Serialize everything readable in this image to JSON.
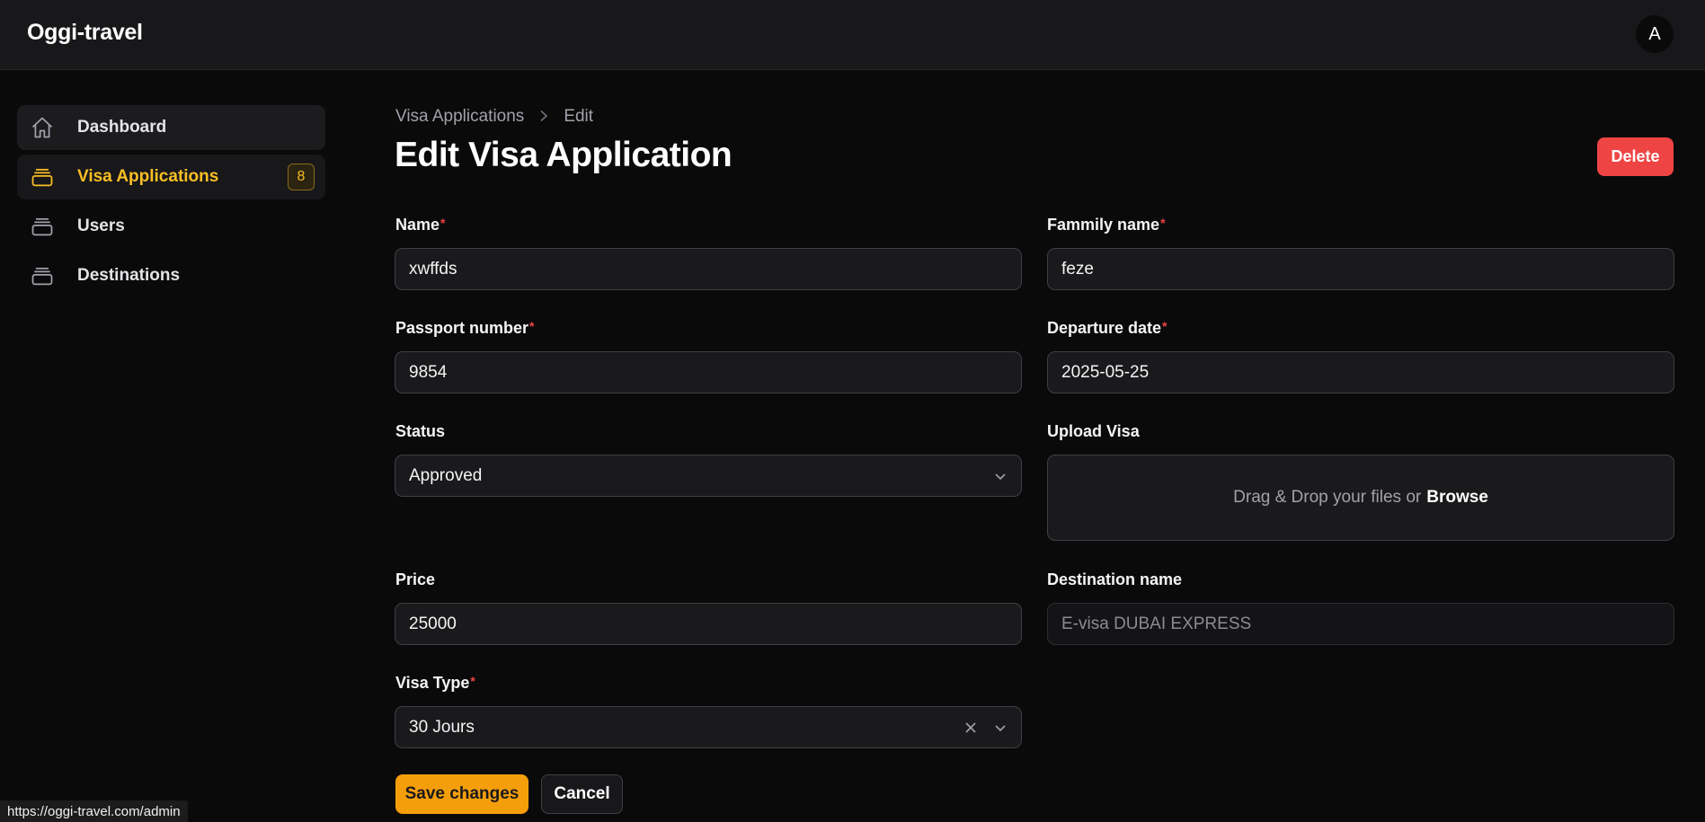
{
  "app": {
    "brand": "Oggi-travel",
    "avatar_initial": "A"
  },
  "sidebar": {
    "items": [
      {
        "label": "Dashboard",
        "icon": "home-icon"
      },
      {
        "label": "Visa Applications",
        "icon": "stack-icon",
        "badge": "8",
        "active": true
      },
      {
        "label": "Users",
        "icon": "stack-icon"
      },
      {
        "label": "Destinations",
        "icon": "stack-icon"
      }
    ]
  },
  "breadcrumb": {
    "parent": "Visa Applications",
    "current": "Edit"
  },
  "page": {
    "title": "Edit Visa Application",
    "delete_label": "Delete"
  },
  "form": {
    "name": {
      "label": "Name",
      "value": "xwffds",
      "required": true
    },
    "family_name": {
      "label": "Fammily name",
      "value": "feze",
      "required": true
    },
    "passport_number": {
      "label": "Passport number",
      "value": "9854",
      "required": true
    },
    "departure_date": {
      "label": "Departure date",
      "value": "2025-05-25",
      "required": true
    },
    "status": {
      "label": "Status",
      "value": "Approved"
    },
    "upload_visa": {
      "label": "Upload Visa",
      "prompt": "Drag & Drop your files or",
      "browse": "Browse"
    },
    "price": {
      "label": "Price",
      "value": "25000"
    },
    "destination_name": {
      "label": "Destination name",
      "value": "E-visa DUBAI EXPRESS"
    },
    "visa_type": {
      "label": "Visa Type",
      "value": "30 Jours",
      "required": true
    },
    "required_marker": "*"
  },
  "actions": {
    "save_label": "Save changes",
    "cancel_label": "Cancel"
  },
  "status_bar": {
    "url": "https://oggi-travel.com/admin"
  },
  "colors": {
    "accent": "#f59e0b",
    "danger": "#ef4444",
    "background": "#0a0a0b"
  }
}
